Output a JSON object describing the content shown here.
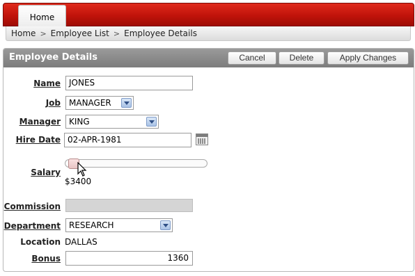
{
  "nav": {
    "tabs": [
      {
        "label": "Home"
      }
    ],
    "breadcrumb": [
      "Home",
      "Employee List",
      "Employee Details"
    ],
    "separator": ">"
  },
  "region": {
    "title": "Employee Details",
    "buttons": {
      "cancel": "Cancel",
      "delete": "Delete",
      "apply": "Apply Changes"
    }
  },
  "form": {
    "name": {
      "label": "Name",
      "value": "JONES"
    },
    "job": {
      "label": "Job",
      "value": "MANAGER"
    },
    "manager": {
      "label": "Manager",
      "value": "KING"
    },
    "hire_date": {
      "label": "Hire Date",
      "value": "02-APR-1981"
    },
    "salary": {
      "label": "Salary",
      "display": "$3400"
    },
    "commission": {
      "label": "Commission",
      "value": ""
    },
    "department": {
      "label": "Department",
      "value": "RESEARCH"
    },
    "location": {
      "label": "Location",
      "value": "DALLAS"
    },
    "bonus": {
      "label": "Bonus",
      "value": "1360"
    }
  },
  "icons": {
    "calendar": "calendar-icon",
    "select_arrow": "chevron-down-icon",
    "cursor": "mouse-pointer-icon"
  },
  "colors": {
    "header_red": "#c0130a",
    "region_header": "#8a8a8a"
  }
}
